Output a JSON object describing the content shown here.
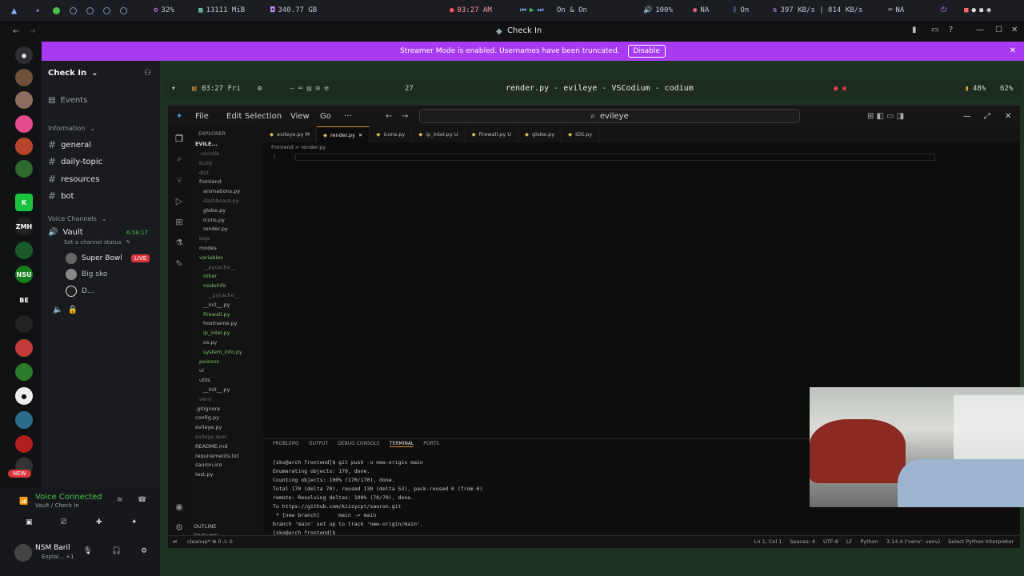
{
  "sysbar": {
    "cpu": "32%",
    "mem": "13111 MiB",
    "disk": "340.77 GB",
    "clock": "03:27 AM",
    "media": "On & On",
    "volume": "100%",
    "vpn": "NA",
    "bt": "On",
    "net": "397 KB/s | 814 KB/s",
    "kbd": "NA"
  },
  "discord": {
    "window_title": "Check In",
    "banner_text": "Streamer Mode is enabled. Usernames have been truncated.",
    "banner_button": "Disable",
    "server_name": "Check In",
    "events_label": "Events",
    "info_category": "Information",
    "text_channels": [
      "general",
      "daily-topic",
      "resources",
      "bot"
    ],
    "voice_category": "Voice Channels",
    "voice_channel": "Vault",
    "voice_timer": "6:58:17",
    "voice_status": "Set a channel status",
    "members": [
      {
        "name": "Super Bowl",
        "live": "LIVE"
      },
      {
        "name": "Big sko",
        "live": ""
      },
      {
        "name": "D...",
        "live": ""
      }
    ],
    "voice_connected": "Voice Connected",
    "voice_location": "Vault / Check In",
    "user_name": "NSM Baril",
    "user_status": "Explai... +1",
    "new_badge": "NEW",
    "rail_labels": [
      "BE",
      "NSU",
      "ZMH"
    ]
  },
  "wm": {
    "time": "03:27 Fri",
    "workspace": "27",
    "title": "render.py - evileye - VSCodium - codium",
    "battery": "48%",
    "volume": "62%"
  },
  "vscode": {
    "menu": [
      "File",
      "Edit",
      "Selection",
      "View",
      "Go",
      "···"
    ],
    "search": "evileye",
    "explorer_title": "EXPLORER",
    "project": "EVILE...",
    "tree": [
      {
        "t": ".vscode",
        "c": "dim"
      },
      {
        "t": "build",
        "c": "dim"
      },
      {
        "t": "dist",
        "c": "dim"
      },
      {
        "t": "frontend",
        "c": ""
      },
      {
        "t": "animations.py",
        "c": ""
      },
      {
        "t": "dashboard.py",
        "c": "dim"
      },
      {
        "t": "globe.py",
        "c": ""
      },
      {
        "t": "icons.py",
        "c": ""
      },
      {
        "t": "render.py",
        "c": ""
      },
      {
        "t": "logs",
        "c": "dim"
      },
      {
        "t": "modes",
        "c": ""
      },
      {
        "t": "variables",
        "c": "g"
      },
      {
        "t": "__pycache__",
        "c": "dim"
      },
      {
        "t": "other",
        "c": "g"
      },
      {
        "t": "nodeinfo",
        "c": "g"
      },
      {
        "t": "__pycache__",
        "c": "dim"
      },
      {
        "t": "__init__.py",
        "c": ""
      },
      {
        "t": "firewall.py",
        "c": "g"
      },
      {
        "t": "hostname.py",
        "c": ""
      },
      {
        "t": "ip_intel.py",
        "c": "g"
      },
      {
        "t": "os.py",
        "c": ""
      },
      {
        "t": "system_info.py",
        "c": "g"
      },
      {
        "t": "poisons",
        "c": "g"
      },
      {
        "t": "ui",
        "c": ""
      },
      {
        "t": "utils",
        "c": ""
      },
      {
        "t": "__init__.py",
        "c": ""
      },
      {
        "t": "venv",
        "c": "dim"
      },
      {
        "t": ".gitignore",
        "c": ""
      },
      {
        "t": "config.py",
        "c": ""
      },
      {
        "t": "evileye.py",
        "c": ""
      },
      {
        "t": "evileye.spec",
        "c": "dim"
      },
      {
        "t": "README.md",
        "c": ""
      },
      {
        "t": "requirements.txt",
        "c": ""
      },
      {
        "t": "sauron.ico",
        "c": ""
      },
      {
        "t": "test.py",
        "c": ""
      }
    ],
    "outline": "OUTLINE",
    "timeline": "TIMELINE",
    "tabs": [
      {
        "label": "evileye.py M",
        "active": false
      },
      {
        "label": "render.py",
        "active": true
      },
      {
        "label": "icons.py",
        "active": false
      },
      {
        "label": "ip_intel.py U",
        "active": false
      },
      {
        "label": "firewall.py U",
        "active": false
      },
      {
        "label": "globe.py",
        "active": false
      },
      {
        "label": "IDS.py",
        "active": false
      }
    ],
    "breadcrumb": "frontend > render.py",
    "line_number": "1",
    "panel_tabs": [
      "PROBLEMS",
      "OUTPUT",
      "DEBUG CONSOLE",
      "TERMINAL",
      "PORTS"
    ],
    "terminal": [
      "[sko@arch frontend]$ git push -u new-origin main",
      "Enumerating objects: 170, done.",
      "Counting objects: 100% (170/170), done.",
      "Total 170 (delta 70), reused 130 (delta 53), pack-reused 0 (from 0)",
      "remote: Resolving deltas: 100% (70/70), done.",
      "To https://github.com/kizzycpt/sauron.git",
      " * [new branch]      main -> main",
      "branch 'main' set up to track 'new-origin/main'.",
      "[sko@arch frontend]$ "
    ],
    "status_left": "cleanup*  ⊗ 0 ⚠ 0",
    "status_right": [
      "Ln 1, Col 1",
      "Spaces: 4",
      "UTF-8",
      "LF",
      "Python",
      "3.14.4 ('venv': venv)",
      "Select Python Interpreter"
    ]
  },
  "colors": {
    "banner": "#a83bf2",
    "live": "#da373c",
    "accent": "#d98a2b"
  }
}
